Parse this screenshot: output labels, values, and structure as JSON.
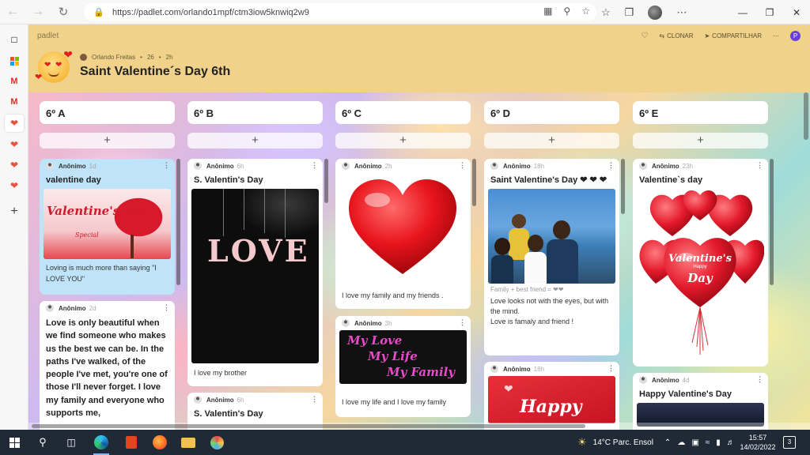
{
  "browser": {
    "url": "https://padlet.com/orlando1mpf/ctm3iow5knwiq2w9"
  },
  "padlet": {
    "brand": "padlet",
    "actions": {
      "clone": "CLONAR",
      "share": "COMPARTILHAR",
      "avatar_letter": "P"
    },
    "author": "Orlando Freitas",
    "likes": "26",
    "age": "2h",
    "title": "Saint Valentine´s Day 6th"
  },
  "columns": [
    {
      "title": "6º A",
      "cards": [
        {
          "author": "Anônimo",
          "time": "1d",
          "title": "valentine day",
          "image_text": "Valentine's Day",
          "image_sub": "Special",
          "body": "Loving is much more than saying \"I LOVE YOU\""
        },
        {
          "author": "Anônimo",
          "time": "2d",
          "body": "Love is only beautiful when we find someone who makes us the best we can be. In the paths I've walked, of the people I've met, you're one of those I'll never forget. I love my family and everyone who supports me,"
        }
      ]
    },
    {
      "title": "6º B",
      "cards": [
        {
          "author": "Anônimo",
          "time": "6h",
          "title": "S. Valentin's Day",
          "image_text": "LOVE",
          "body": "I love my brother"
        },
        {
          "author": "Anônimo",
          "time": "6h",
          "title": "S. Valentin's Day"
        }
      ]
    },
    {
      "title": "6º C",
      "cards": [
        {
          "author": "Anônimo",
          "time": "2h",
          "body": "I love my family and my friends ."
        },
        {
          "author": "Anônimo",
          "time": "3h",
          "image_lines": [
            "My Love",
            "My Life",
            "My Family"
          ],
          "body": "I love my life and I love my family"
        }
      ]
    },
    {
      "title": "6º D",
      "cards": [
        {
          "author": "Anônimo",
          "time": "18h",
          "title": "Saint Valentine's Day ❤ ❤ ❤",
          "caption": "Family + best friend = ❤❤",
          "body_lines": [
            "Love looks not with the eyes, but with the mind.",
            "Love is famaly and friend !"
          ]
        },
        {
          "author": "Anônimo",
          "time": "18h",
          "image_text": "Happy"
        }
      ]
    },
    {
      "title": "6º E",
      "cards": [
        {
          "author": "Anônimo",
          "time": "23h",
          "title": "Valentine`s day",
          "image_text": "Valentine's",
          "image_sub": "Happy",
          "image_text2": "Day"
        },
        {
          "author": "Anônimo",
          "time": "4d",
          "title": "Happy Valentine's Day"
        }
      ]
    }
  ],
  "taskbar": {
    "weather": "14°C  Parc. Ensol",
    "time": "15:57",
    "date": "14/02/2022",
    "notifications": "3"
  },
  "colors": {
    "header": "#f1d28a",
    "card_blue": "#bfe3f8",
    "taskbar": "#1f2a36"
  }
}
